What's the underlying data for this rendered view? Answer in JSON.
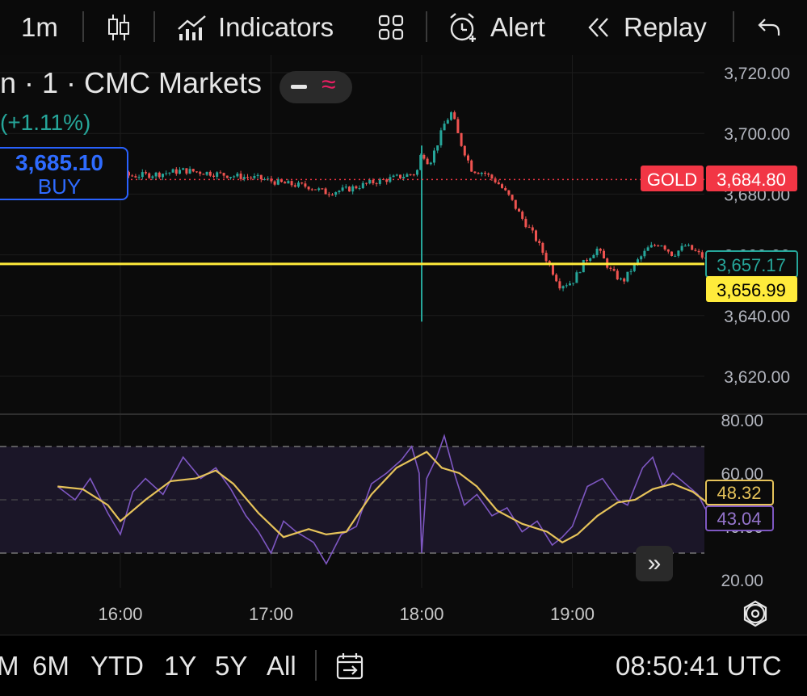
{
  "toolbar": {
    "interval": "1m",
    "indicators_label": "Indicators",
    "alert_label": "Alert",
    "replay_label": "Replay"
  },
  "legend": {
    "title": "n · 1 · CMC Markets",
    "change": "(+1.11%)",
    "buy_price": "3,685.10",
    "buy_label": "BUY"
  },
  "badges": {
    "gold_label": "GOLD",
    "gold_price": "3,684.80",
    "price_line": "3,657.17",
    "yellow_line": "3,656.99",
    "rsi_value": "43.04",
    "rsi_ma_value": "48.32"
  },
  "chart_data": [
    {
      "type": "candlestick",
      "title": "",
      "y_ticks": [
        "3,720.00",
        "3,700.00",
        "3,680.00",
        "3,660.00",
        "3,640.00",
        "3,620.00"
      ],
      "ylim": [
        3612,
        3726
      ],
      "x_ticks": [
        "16:00",
        "17:00",
        "18:00",
        "19:00"
      ],
      "close_series": [
        {
          "t": "15:35",
          "v": 3685.5
        },
        {
          "t": "15:45",
          "v": 3686.0
        },
        {
          "t": "15:55",
          "v": 3686.8
        },
        {
          "t": "16:05",
          "v": 3686.0
        },
        {
          "t": "16:15",
          "v": 3686.6
        },
        {
          "t": "16:25",
          "v": 3687.8
        },
        {
          "t": "16:35",
          "v": 3687.0
        },
        {
          "t": "16:45",
          "v": 3686.0
        },
        {
          "t": "16:55",
          "v": 3685.2
        },
        {
          "t": "17:05",
          "v": 3683.5
        },
        {
          "t": "17:15",
          "v": 3682.5
        },
        {
          "t": "17:22",
          "v": 3680.5
        },
        {
          "t": "17:30",
          "v": 3681.5
        },
        {
          "t": "17:40",
          "v": 3683.8
        },
        {
          "t": "17:50",
          "v": 3685.5
        },
        {
          "t": "17:58",
          "v": 3687.0
        },
        {
          "t": "18:00",
          "v": 3694.0
        },
        {
          "t": "18:03",
          "v": 3690.0
        },
        {
          "t": "18:06",
          "v": 3696.0
        },
        {
          "t": "18:09",
          "v": 3703.0
        },
        {
          "t": "18:12",
          "v": 3707.0
        },
        {
          "t": "18:15",
          "v": 3698.0
        },
        {
          "t": "18:20",
          "v": 3688.0
        },
        {
          "t": "18:25",
          "v": 3687.0
        },
        {
          "t": "18:30",
          "v": 3684.0
        },
        {
          "t": "18:35",
          "v": 3679.0
        },
        {
          "t": "18:40",
          "v": 3672.0
        },
        {
          "t": "18:45",
          "v": 3666.0
        },
        {
          "t": "18:50",
          "v": 3658.0
        },
        {
          "t": "18:55",
          "v": 3650.0
        },
        {
          "t": "19:00",
          "v": 3651.0
        },
        {
          "t": "19:05",
          "v": 3658.0
        },
        {
          "t": "19:10",
          "v": 3662.0
        },
        {
          "t": "19:15",
          "v": 3655.0
        },
        {
          "t": "19:20",
          "v": 3651.0
        },
        {
          "t": "19:25",
          "v": 3657.0
        },
        {
          "t": "19:30",
          "v": 3662.0
        },
        {
          "t": "19:35",
          "v": 3664.0
        },
        {
          "t": "19:40",
          "v": 3660.0
        },
        {
          "t": "19:45",
          "v": 3663.0
        },
        {
          "t": "19:50",
          "v": 3660.5
        },
        {
          "t": "19:55",
          "v": 3657.2
        }
      ],
      "spike_low": 3638,
      "spike_time": "18:00",
      "price_line": 3684.8,
      "horizontal_line": 3656.99
    },
    {
      "type": "line",
      "title": "",
      "y_ticks": [
        "80.00",
        "60.00",
        "40.00",
        "20.00"
      ],
      "ylim": [
        20,
        80
      ],
      "bands": [
        30,
        70
      ],
      "series": [
        {
          "name": "",
          "color": "#7e57c2",
          "values": [
            {
              "t": "15:35",
              "v": 55
            },
            {
              "t": "15:42",
              "v": 50
            },
            {
              "t": "15:48",
              "v": 58
            },
            {
              "t": "15:55",
              "v": 45
            },
            {
              "t": "16:00",
              "v": 37
            },
            {
              "t": "16:05",
              "v": 53
            },
            {
              "t": "16:10",
              "v": 58
            },
            {
              "t": "16:17",
              "v": 52
            },
            {
              "t": "16:25",
              "v": 66
            },
            {
              "t": "16:32",
              "v": 58
            },
            {
              "t": "16:38",
              "v": 62
            },
            {
              "t": "16:44",
              "v": 54
            },
            {
              "t": "16:50",
              "v": 44
            },
            {
              "t": "16:55",
              "v": 38
            },
            {
              "t": "17:00",
              "v": 30
            },
            {
              "t": "17:05",
              "v": 42
            },
            {
              "t": "17:10",
              "v": 38
            },
            {
              "t": "17:17",
              "v": 34
            },
            {
              "t": "17:22",
              "v": 26
            },
            {
              "t": "17:28",
              "v": 37
            },
            {
              "t": "17:34",
              "v": 40
            },
            {
              "t": "17:40",
              "v": 56
            },
            {
              "t": "17:46",
              "v": 60
            },
            {
              "t": "17:52",
              "v": 65
            },
            {
              "t": "17:56",
              "v": 70
            },
            {
              "t": "17:59",
              "v": 60
            },
            {
              "t": "18:00",
              "v": 30
            },
            {
              "t": "18:02",
              "v": 58
            },
            {
              "t": "18:06",
              "v": 66
            },
            {
              "t": "18:09",
              "v": 74
            },
            {
              "t": "18:13",
              "v": 60
            },
            {
              "t": "18:17",
              "v": 48
            },
            {
              "t": "18:22",
              "v": 52
            },
            {
              "t": "18:28",
              "v": 44
            },
            {
              "t": "18:34",
              "v": 47
            },
            {
              "t": "18:40",
              "v": 38
            },
            {
              "t": "18:46",
              "v": 42
            },
            {
              "t": "18:52",
              "v": 33
            },
            {
              "t": "18:56",
              "v": 36
            },
            {
              "t": "19:00",
              "v": 40
            },
            {
              "t": "19:06",
              "v": 55
            },
            {
              "t": "19:12",
              "v": 58
            },
            {
              "t": "19:18",
              "v": 50
            },
            {
              "t": "19:22",
              "v": 48
            },
            {
              "t": "19:28",
              "v": 62
            },
            {
              "t": "19:32",
              "v": 66
            },
            {
              "t": "19:36",
              "v": 55
            },
            {
              "t": "19:40",
              "v": 60
            },
            {
              "t": "19:45",
              "v": 56
            },
            {
              "t": "19:50",
              "v": 52
            },
            {
              "t": "19:55",
              "v": 43
            }
          ]
        },
        {
          "name": "",
          "color": "#e6c35a",
          "values": [
            {
              "t": "15:35",
              "v": 55
            },
            {
              "t": "15:45",
              "v": 54
            },
            {
              "t": "15:55",
              "v": 48
            },
            {
              "t": "16:00",
              "v": 42
            },
            {
              "t": "16:10",
              "v": 50
            },
            {
              "t": "16:20",
              "v": 57
            },
            {
              "t": "16:30",
              "v": 58
            },
            {
              "t": "16:38",
              "v": 61
            },
            {
              "t": "16:45",
              "v": 56
            },
            {
              "t": "16:55",
              "v": 45
            },
            {
              "t": "17:05",
              "v": 36
            },
            {
              "t": "17:15",
              "v": 39
            },
            {
              "t": "17:22",
              "v": 37
            },
            {
              "t": "17:30",
              "v": 38
            },
            {
              "t": "17:40",
              "v": 52
            },
            {
              "t": "17:50",
              "v": 62
            },
            {
              "t": "17:58",
              "v": 66
            },
            {
              "t": "18:02",
              "v": 68
            },
            {
              "t": "18:08",
              "v": 62
            },
            {
              "t": "18:15",
              "v": 60
            },
            {
              "t": "18:22",
              "v": 55
            },
            {
              "t": "18:30",
              "v": 46
            },
            {
              "t": "18:40",
              "v": 41
            },
            {
              "t": "18:50",
              "v": 38
            },
            {
              "t": "18:56",
              "v": 34
            },
            {
              "t": "19:02",
              "v": 37
            },
            {
              "t": "19:10",
              "v": 44
            },
            {
              "t": "19:18",
              "v": 49
            },
            {
              "t": "19:25",
              "v": 50
            },
            {
              "t": "19:32",
              "v": 54
            },
            {
              "t": "19:40",
              "v": 56
            },
            {
              "t": "19:48",
              "v": 53
            },
            {
              "t": "19:55",
              "v": 48
            }
          ]
        }
      ]
    }
  ],
  "bottombar": {
    "ranges": [
      "M",
      "6M",
      "YTD",
      "1Y",
      "5Y",
      "All"
    ],
    "clock": "08:50:41 UTC"
  },
  "colors": {
    "up": "#26a69a",
    "down": "#ef5350",
    "gold": "#f23645",
    "yellow": "#ffeb3b",
    "buy_blue": "#2962ff"
  }
}
